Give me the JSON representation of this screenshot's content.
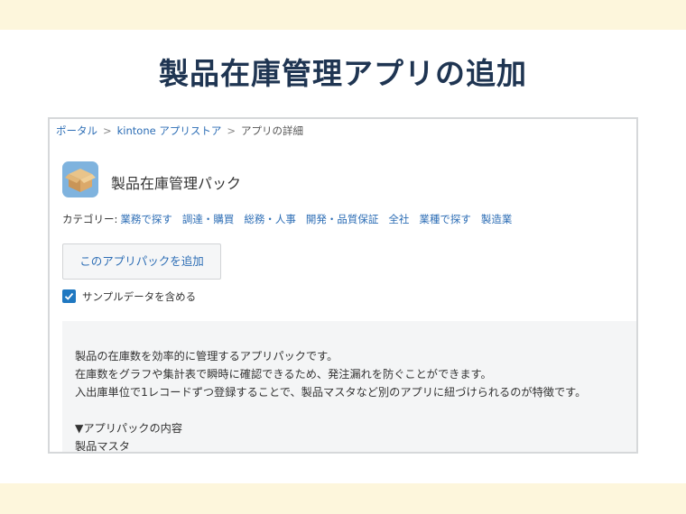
{
  "slide": {
    "title": "製品在庫管理アプリの追加"
  },
  "breadcrumb": {
    "portal": "ポータル",
    "separator": ">",
    "store": "kintone アプリストア",
    "current": "アプリの詳細"
  },
  "pack": {
    "title": "製品在庫管理パック",
    "icon": "cardboard-box-icon"
  },
  "categories": {
    "label": "カテゴリー:",
    "items": [
      "業務で探す",
      "調達・購買",
      "総務・人事",
      "開発・品質保証",
      "全社",
      "業種で探す",
      "製造業"
    ]
  },
  "actions": {
    "add_button": "このアプリパックを追加"
  },
  "sample": {
    "label": "サンプルデータを含める",
    "checked": true
  },
  "description": {
    "lines": [
      "製品の在庫数を効率的に管理するアプリパックです。",
      "在庫数をグラフや集計表で瞬時に確認できるため、発注漏れを防ぐことができます。",
      "入出庫単位で1レコードずつ登録することで、製品マスタなど別のアプリに紐づけられるのが特徴です。"
    ],
    "contents_heading": "▼アプリパックの内容",
    "contents_items": [
      "製品マスタ"
    ]
  },
  "colors": {
    "accent": "#1f78c1",
    "link": "#2c6db5",
    "title": "#1f3552",
    "band": "#fdf6dc"
  }
}
